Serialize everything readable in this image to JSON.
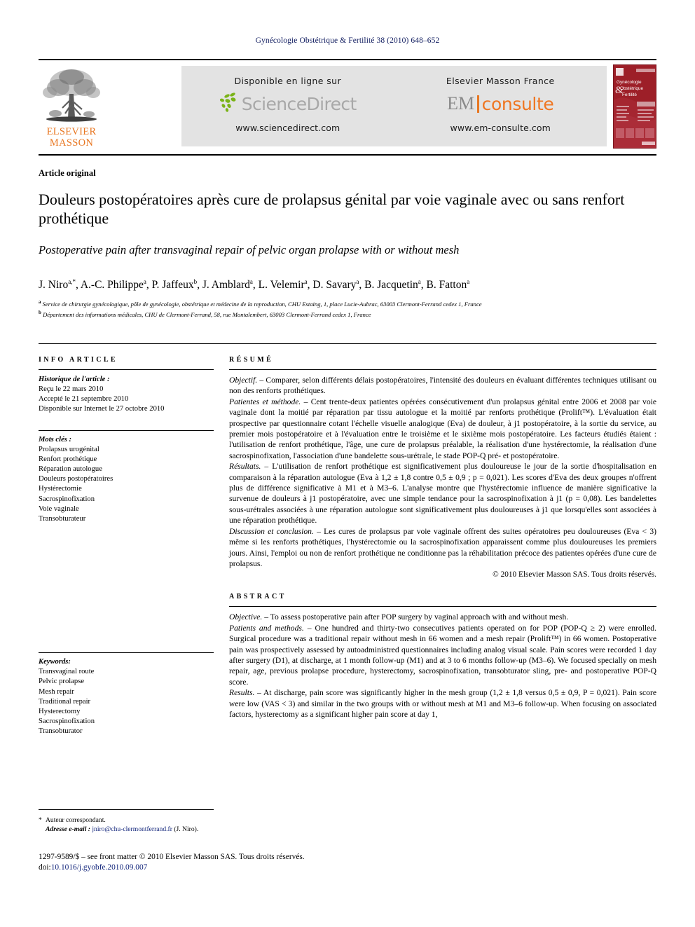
{
  "running_head": "Gynécologie Obstétrique & Fertilité 38 (2010) 648–652",
  "header": {
    "publisher_logo": {
      "line1": "ELSEVIER",
      "line2": "MASSON",
      "icon": "elsevier-tree-logo",
      "color": "#e87722"
    },
    "sciencedirect": {
      "lead": "Disponible en ligne sur",
      "logo_text": "ScienceDirect",
      "url": "www.sciencedirect.com",
      "leaf_color": "#7ab317",
      "text_color": "#a8a8a8"
    },
    "emconsulte": {
      "lead": "Elsevier Masson France",
      "logo_prefix": "EM",
      "logo_suffix": "consulte",
      "url": "www.em-consulte.com",
      "accent_color": "#ef7622"
    },
    "cover": {
      "title_line1": "Gynécologie",
      "title_line2": "Obstétrique",
      "title_line3": "Fertilité",
      "ampersand": "&",
      "background": "#9d1f28"
    }
  },
  "article": {
    "type": "Article original",
    "title_fr": "Douleurs postopératoires après cure de prolapsus génital par voie vaginale avec ou sans renfort prothétique",
    "title_en": "Postoperative pain after transvaginal repair of pelvic organ prolapse with or without mesh",
    "authors_html": "J. Niro<sup>a,*</sup>, A.-C. Philippe<sup>a</sup>, P. Jaffeux<sup>b</sup>, J. Amblard<sup>a</sup>, L. Velemir<sup>a</sup>, D. Savary<sup>a</sup>, B. Jacquetin<sup>a</sup>, B. Fatton<sup>a</sup>",
    "affiliation_a": "Service de chirurgie gynécologique, pôle de gynécologie, obstétrique et médecine de la reproduction, CHU Estaing, 1, place Lucie-Aubrac, 63003 Clermont-Ferrand cedex 1, France",
    "affiliation_b": "Département des informations médicales, CHU de Clermont-Ferrand, 58, rue Montalembert, 63003 Clermont-Ferrand cedex 1, France"
  },
  "info_article": {
    "heading": "INFO ARTICLE",
    "history_label": "Historique de l'article :",
    "history": [
      "Reçu le 22 mars 2010",
      "Accepté le 21 septembre 2010",
      "Disponible sur Internet le 27 octobre 2010"
    ],
    "keywords_label": "Mots clés :",
    "keywords": [
      "Prolapsus urogénital",
      "Renfort prothétique",
      "Réparation autologue",
      "Douleurs postopératoires",
      "Hystérectomie",
      "Sacrospinofixation",
      "Voie vaginale",
      "Transobturateur"
    ]
  },
  "keywords_en": {
    "label": "Keywords:",
    "items": [
      "Transvaginal route",
      "Pelvic prolapse",
      "Mesh repair",
      "Traditional repair",
      "Hysterectomy",
      "Sacrospinofixation",
      "Transobturator"
    ]
  },
  "resume": {
    "heading": "RÉSUMÉ",
    "objectif_label": "Objectif.",
    "objectif_text": " – Comparer, selon différents délais postopératoires, l'intensité des douleurs en évaluant différentes techniques utilisant ou non des renforts prothétiques.",
    "patientes_label": "Patientes et méthode.",
    "patientes_text": " – Cent trente-deux patientes opérées consécutivement d'un prolapsus génital entre 2006 et 2008 par voie vaginale dont la moitié par réparation par tissu autologue et la moitié par renforts prothétique (Prolift™). L'évaluation était prospective par questionnaire cotant l'échelle visuelle analogique (Eva) de douleur, à j1 postopératoire, à la sortie du service, au premier mois postopératoire et à l'évaluation entre le troisième et le sixième mois postopératoire. Les facteurs étudiés étaient : l'utilisation de renfort prothétique, l'âge, une cure de prolapsus préalable, la réalisation d'une hystérectomie, la réalisation d'une sacrospinofixation, l'association d'une bandelette sous-urétrale, le stade POP-Q pré- et postopératoire.",
    "resultats_label": "Résultats.",
    "resultats_text": " – L'utilisation de renfort prothétique est significativement plus douloureuse le jour de la sortie d'hospitalisation en comparaison à la réparation autologue (Eva à 1,2 ± 1,8 contre 0,5 ± 0,9 ; p = 0,021). Les scores d'Eva des deux groupes n'offrent plus de différence significative à M1 et à M3–6. L'analyse montre que l'hystérectomie influence de manière significative la survenue de douleurs à j1 postopératoire, avec une simple tendance pour la sacrospinofixation à j1 (p = 0,08). Les bandelettes sous-urétrales associées à une réparation autologue sont significativement plus douloureuses à j1 que lorsqu'elles sont associées à une réparation prothétique.",
    "discussion_label": "Discussion et conclusion.",
    "discussion_text": " – Les cures de prolapsus par voie vaginale offrent des suites opératoires peu douloureuses (Eva < 3) même si les renforts prothétiques, l'hystérectomie ou la sacrospinofixation apparaissent comme plus douloureuses les premiers jours. Ainsi, l'emploi ou non de renfort prothétique ne conditionne pas la réhabilitation précoce des patientes opérées d'une cure de prolapsus.",
    "copyright": "© 2010 Elsevier Masson SAS. Tous droits réservés."
  },
  "abstract": {
    "heading": "ABSTRACT",
    "objective_label": "Objective.",
    "objective_text": " – To assess postoperative pain after POP surgery by vaginal approach with and without mesh.",
    "methods_label": "Patients and methods.",
    "methods_text": " – One hundred and thirty-two consecutives patients operated on for POP (POP-Q ≥ 2) were enrolled. Surgical procedure was a traditional repair without mesh in 66 women and a mesh repair (Prolift™) in 66 women. Postoperative pain was prospectively assessed by autoadministred questionnaires including analog visual scale. Pain scores were recorded 1 day after surgery (D1), at discharge, at 1 month follow-up (M1) and at 3 to 6 months follow-up (M3–6). We focused specially on mesh repair, age, previous prolapse procedure, hysterectomy, sacrospinofixation, transobturator sling, pre- and postoperative POP-Q score.",
    "results_label": "Results.",
    "results_text": " –  At discharge, pain score was significantly higher in the mesh group (1,2 ± 1,8 versus 0,5 ± 0,9, P = 0,021). Pain score were low (VAS < 3) and similar in the two groups with or without mesh at M1 and M3–6 follow-up. When focusing on associated factors, hysterectomy as a significant higher pain score at day 1,"
  },
  "footer": {
    "corresponding_marker": "*",
    "corresponding_label": "Auteur correspondant.",
    "email_label": "Adresse e-mail :",
    "email": "jniro@chu-clermontferrand.fr",
    "email_suffix": "(J. Niro).",
    "issn_line": "1297-9589/$ – see front matter © 2010 Elsevier Masson SAS. Tous droits réservés.",
    "doi_label": "doi:",
    "doi": "10.1016/j.gyobfe.2010.09.007",
    "link_color": "#12257b"
  }
}
